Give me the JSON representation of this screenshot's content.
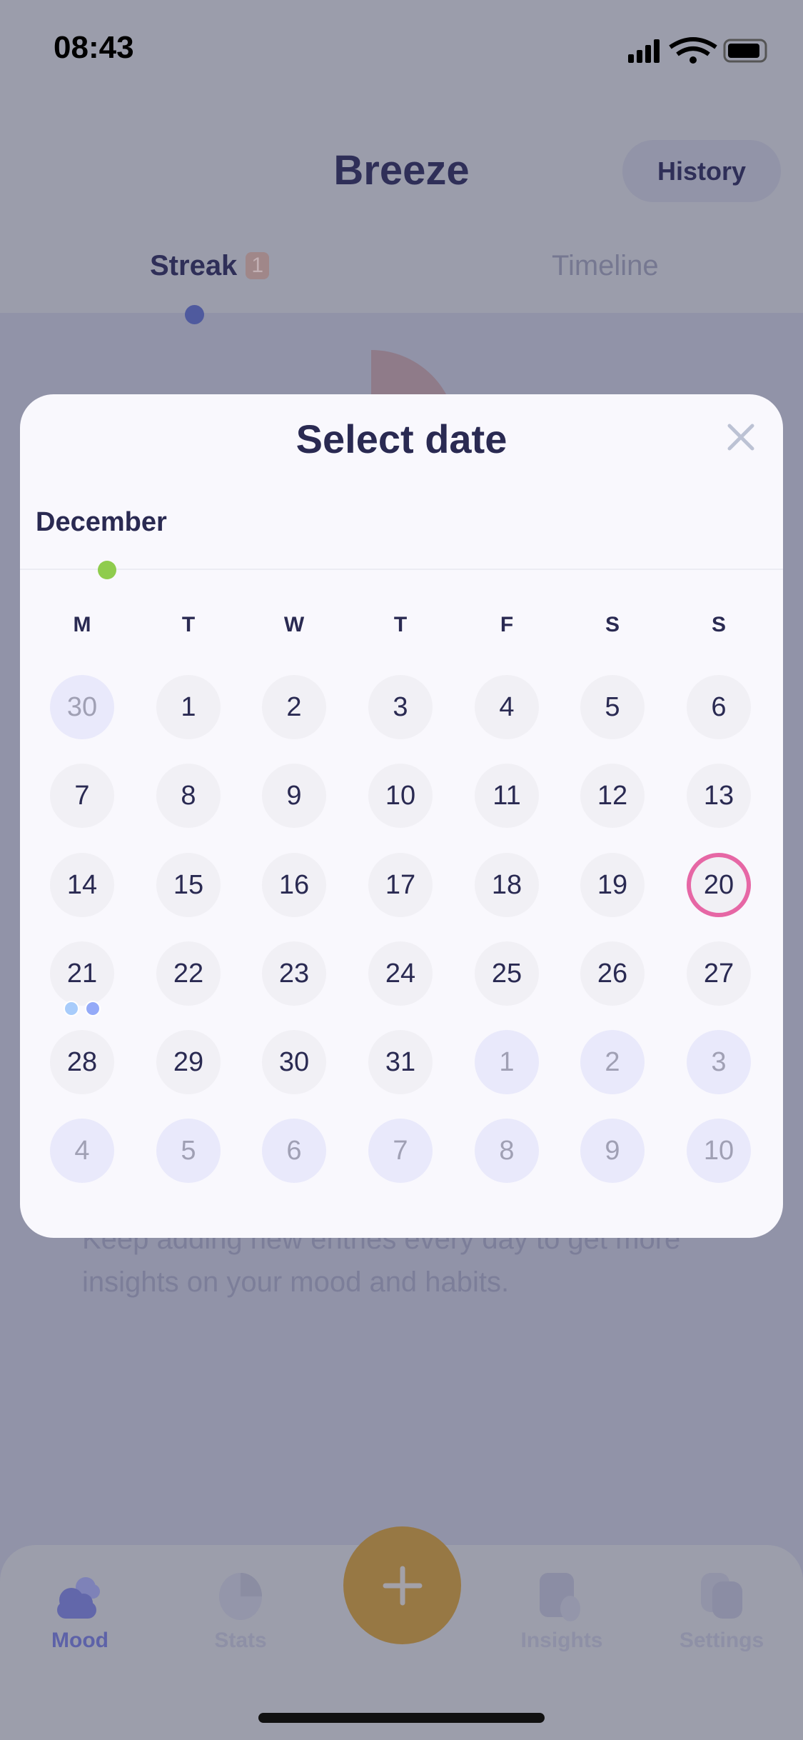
{
  "status": {
    "time": "08:43"
  },
  "header": {
    "title": "Breeze",
    "history_label": "History"
  },
  "tabs": [
    {
      "label": "Streak",
      "badge": "1"
    },
    {
      "label": "Timeline"
    }
  ],
  "background_text": "Keep adding new entries every day to get more insights on your mood and habits.",
  "modal": {
    "title": "Select date",
    "month": "December",
    "weekdays": [
      "M",
      "T",
      "W",
      "T",
      "F",
      "S",
      "S"
    ],
    "days": [
      {
        "d": "30",
        "other": true
      },
      {
        "d": "1"
      },
      {
        "d": "2"
      },
      {
        "d": "3"
      },
      {
        "d": "4"
      },
      {
        "d": "5"
      },
      {
        "d": "6"
      },
      {
        "d": "7"
      },
      {
        "d": "8"
      },
      {
        "d": "9"
      },
      {
        "d": "10"
      },
      {
        "d": "11"
      },
      {
        "d": "12"
      },
      {
        "d": "13"
      },
      {
        "d": "14"
      },
      {
        "d": "15"
      },
      {
        "d": "16"
      },
      {
        "d": "17"
      },
      {
        "d": "18"
      },
      {
        "d": "19"
      },
      {
        "d": "20",
        "selected": true
      },
      {
        "d": "21",
        "entries": [
          "#a8ccfb",
          "#94aaf8"
        ]
      },
      {
        "d": "22"
      },
      {
        "d": "23"
      },
      {
        "d": "24"
      },
      {
        "d": "25"
      },
      {
        "d": "26"
      },
      {
        "d": "27"
      },
      {
        "d": "28"
      },
      {
        "d": "29"
      },
      {
        "d": "30"
      },
      {
        "d": "31"
      },
      {
        "d": "1",
        "other": true
      },
      {
        "d": "2",
        "other": true
      },
      {
        "d": "3",
        "other": true
      },
      {
        "d": "4",
        "other": true
      },
      {
        "d": "5",
        "other": true
      },
      {
        "d": "6",
        "other": true
      },
      {
        "d": "7",
        "other": true
      },
      {
        "d": "8",
        "other": true
      },
      {
        "d": "9",
        "other": true
      },
      {
        "d": "10",
        "other": true
      }
    ],
    "colors": {
      "selected_ring": "#e667a5",
      "month_dot": "#8fcc4d"
    }
  },
  "nav": [
    {
      "label": "Mood",
      "icon": "cloud-icon",
      "active": true
    },
    {
      "label": "Stats",
      "icon": "pie-chart-icon"
    },
    {
      "label": "Insights",
      "icon": "insights-icon"
    },
    {
      "label": "Settings",
      "icon": "settings-icon"
    }
  ],
  "fab": {
    "icon": "plus-icon",
    "color": "#977844"
  }
}
